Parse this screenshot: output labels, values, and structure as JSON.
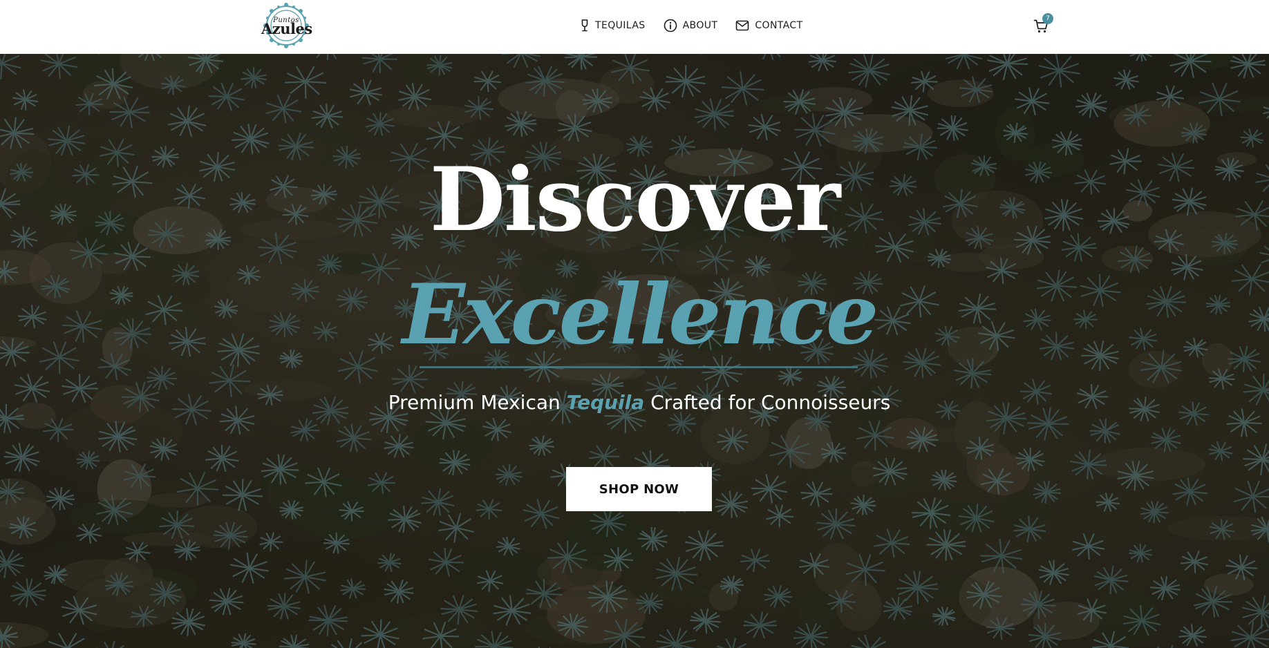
{
  "brand": {
    "logo_small": "Puntos",
    "logo_big": "Azules"
  },
  "nav": {
    "items": [
      {
        "label": "TEQUILAS",
        "icon": "glass-icon"
      },
      {
        "label": "ABOUT",
        "icon": "info-icon"
      },
      {
        "label": "CONTACT",
        "icon": "mail-icon"
      }
    ]
  },
  "cart": {
    "icon": "cart-icon",
    "count": "7"
  },
  "hero": {
    "headline_1": "Discover",
    "headline_2": "Excellence",
    "subtitle_before": "Premium Mexican ",
    "subtitle_accent": "Tequila",
    "subtitle_after": " Crafted for Connoisseurs",
    "cta_label": "SHOP NOW",
    "background": "aerial view of agave field"
  },
  "colors": {
    "accent": "#5aa2b1",
    "header_bg": "#ffffff",
    "badge": "#4a8fa0"
  }
}
